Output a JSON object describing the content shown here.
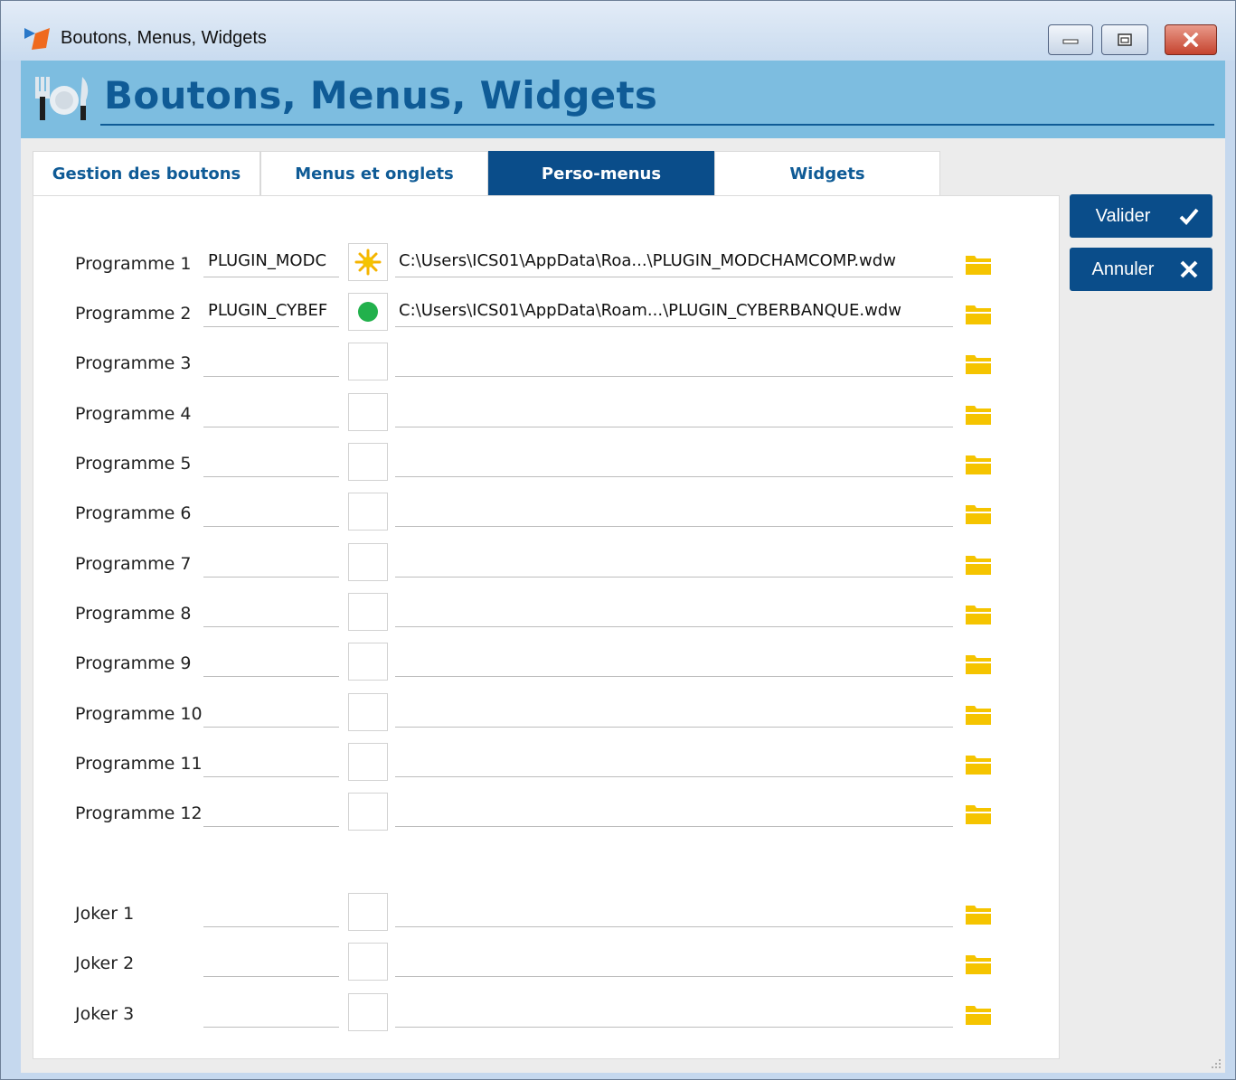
{
  "window": {
    "title": "Boutons, Menus, Widgets",
    "controls": [
      "minimize",
      "maximize",
      "close"
    ]
  },
  "banner": {
    "title": "Boutons, Menus, Widgets",
    "icon": "cutlery-plate-icon"
  },
  "tabs": [
    {
      "label": "Gestion des boutons",
      "active": false
    },
    {
      "label": "Menus et onglets",
      "active": false
    },
    {
      "label": "Perso-menus",
      "active": true
    },
    {
      "label": "Widgets",
      "active": false
    }
  ],
  "buttons": {
    "valider": "Valider",
    "annuler": "Annuler"
  },
  "rows": [
    {
      "label": "Programme 1",
      "name": "PLUGIN_MODC",
      "icon": "sun-icon",
      "path": "C:\\Users\\ICS01\\AppData\\Roa...\\PLUGIN_MODCHAMCOMP.wdw"
    },
    {
      "label": "Programme 2",
      "name": "PLUGIN_CYBEF",
      "icon": "green-dot-icon",
      "path": "C:\\Users\\ICS01\\AppData\\Roam...\\PLUGIN_CYBERBANQUE.wdw"
    },
    {
      "label": "Programme 3",
      "name": "",
      "icon": "",
      "path": ""
    },
    {
      "label": "Programme 4",
      "name": "",
      "icon": "",
      "path": ""
    },
    {
      "label": "Programme 5",
      "name": "",
      "icon": "",
      "path": ""
    },
    {
      "label": "Programme 6",
      "name": "",
      "icon": "",
      "path": ""
    },
    {
      "label": "Programme 7",
      "name": "",
      "icon": "",
      "path": ""
    },
    {
      "label": "Programme 8",
      "name": "",
      "icon": "",
      "path": ""
    },
    {
      "label": "Programme 9",
      "name": "",
      "icon": "",
      "path": ""
    },
    {
      "label": "Programme 10",
      "name": "",
      "icon": "",
      "path": ""
    },
    {
      "label": "Programme 11",
      "name": "",
      "icon": "",
      "path": ""
    },
    {
      "label": "Programme 12",
      "name": "",
      "icon": "",
      "path": ""
    },
    {
      "label": "Joker 1",
      "name": "",
      "icon": "",
      "path": ""
    },
    {
      "label": "Joker 2",
      "name": "",
      "icon": "",
      "path": ""
    },
    {
      "label": "Joker 3",
      "name": "",
      "icon": "",
      "path": ""
    }
  ],
  "colors": {
    "accent": "#0a4d8a",
    "banner": "#7dbde0",
    "folder": "#f5c400"
  }
}
